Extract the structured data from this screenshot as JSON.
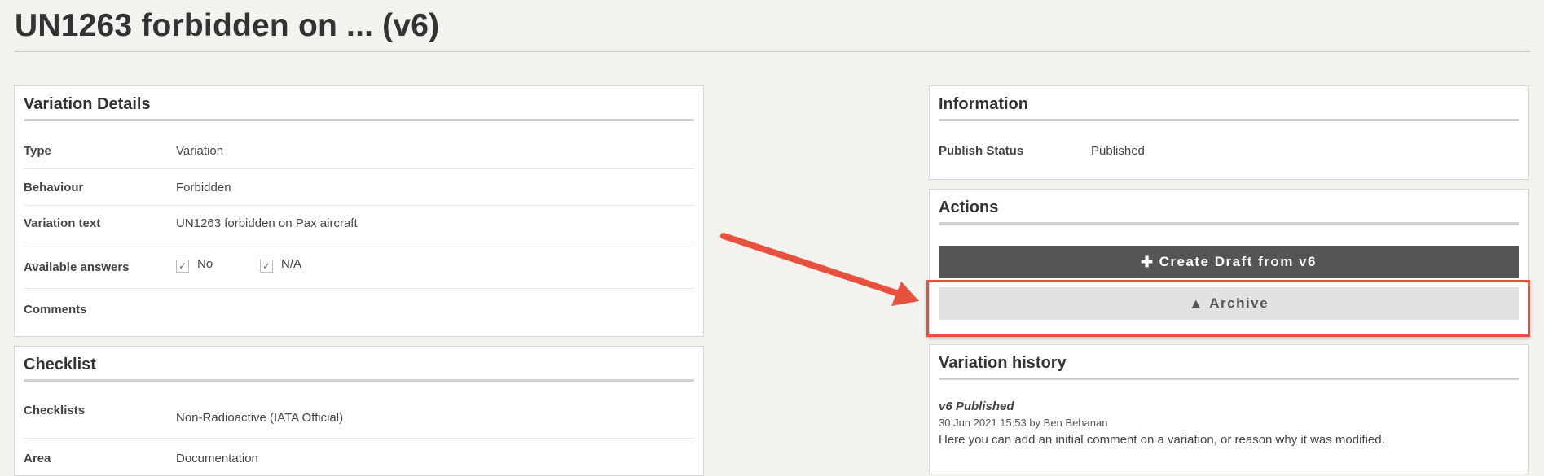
{
  "page": {
    "title": "UN1263 forbidden on ... (v6)"
  },
  "variation_details": {
    "heading": "Variation Details",
    "rows": [
      {
        "label": "Type",
        "value": "Variation"
      },
      {
        "label": "Behaviour",
        "value": "Forbidden"
      },
      {
        "label": "Variation text",
        "value": "UN1263 forbidden on Pax aircraft"
      },
      {
        "label": "Available answers",
        "answers": [
          "No",
          "N/A"
        ]
      },
      {
        "label": "Comments",
        "value": ""
      }
    ]
  },
  "checklist": {
    "heading": "Checklist",
    "rows": [
      {
        "label": "Checklists",
        "value": "Non-Radioactive (IATA Official)"
      },
      {
        "label": "Area",
        "value": "Documentation"
      }
    ]
  },
  "information": {
    "heading": "Information",
    "rows": [
      {
        "label": "Publish Status",
        "value": "Published"
      }
    ]
  },
  "actions": {
    "heading": "Actions",
    "create_draft_label": "Create Draft from v6",
    "archive_label": "Archive"
  },
  "variation_history": {
    "heading": "Variation history",
    "entries": [
      {
        "title": "v6 Published",
        "meta": "30 Jun 2021 15:53 by Ben Behanan",
        "text": "Here you can add an initial comment on a variation, or reason why it was modified."
      }
    ]
  },
  "colors": {
    "annotation": "#e8513e",
    "dark_button": "#555555",
    "light_button": "#e2e2e2"
  },
  "icons": {
    "create": "plus-icon",
    "archive": "warning-icon"
  }
}
